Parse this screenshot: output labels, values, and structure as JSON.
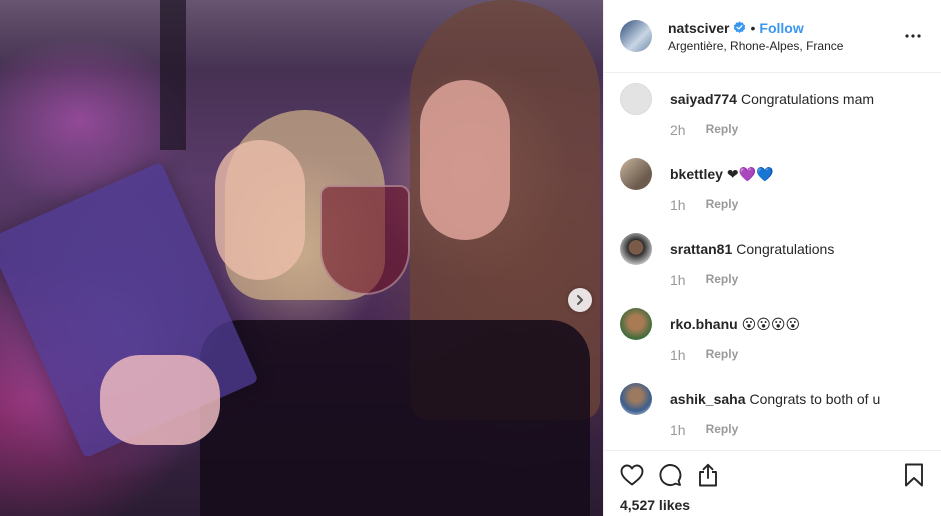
{
  "post": {
    "author": "natsciver",
    "follow_label": "Follow",
    "dot": "•",
    "location": "Argentière, Rhone-Alpes, France",
    "likes": "4,527 likes"
  },
  "comments": [
    {
      "username": "saiyad774",
      "text": "Congratulations mam",
      "time": "2h",
      "reply": "Reply"
    },
    {
      "username": "bkettley",
      "text": "❤💜💙",
      "time": "1h",
      "reply": "Reply"
    },
    {
      "username": "srattan81",
      "text": "Congratulations",
      "time": "1h",
      "reply": "Reply"
    },
    {
      "username": "rko.bhanu",
      "text": "😮😮😮😮",
      "time": "1h",
      "reply": "Reply"
    },
    {
      "username": "ashik_saha",
      "text": "Congrats to both of u",
      "time": "1h",
      "reply": "Reply"
    }
  ],
  "colors": {
    "link_blue": "#3897f0",
    "text": "#262626",
    "muted": "#999999",
    "border": "#efefef"
  },
  "icons": {
    "verified": "verified-badge-icon",
    "more": "more-options-icon",
    "next": "chevron-right-icon",
    "like": "heart-icon",
    "comment": "comment-bubble-icon",
    "share": "share-icon",
    "save": "bookmark-icon"
  }
}
